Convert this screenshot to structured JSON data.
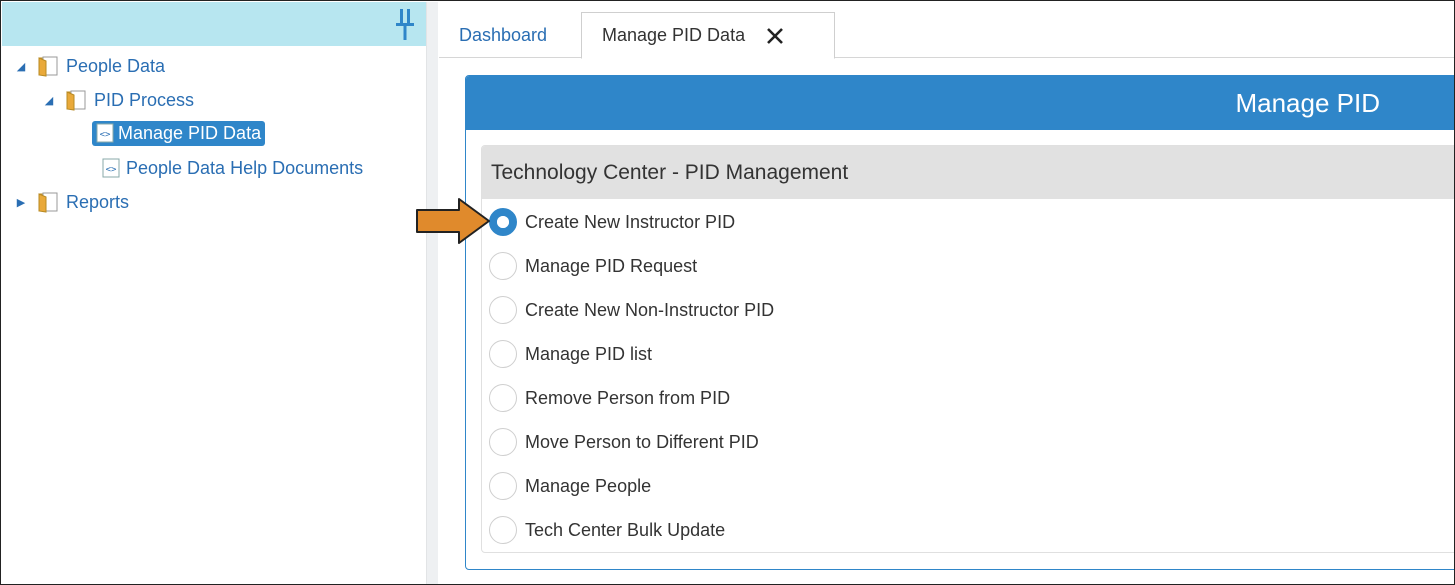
{
  "sidebar": {
    "tree": [
      {
        "label": "People Data",
        "expanded": true
      },
      {
        "label": "PID Process",
        "expanded": true
      },
      {
        "label": "Manage PID Data",
        "selected": true
      },
      {
        "label": "People Data Help Documents"
      },
      {
        "label": "Reports",
        "expanded": false
      }
    ],
    "pin_icon": "pin-icon"
  },
  "tabs": [
    {
      "label": "Dashboard"
    },
    {
      "label": "Manage PID Data",
      "active": true,
      "close_icon": "close-icon"
    }
  ],
  "panel": {
    "title": "Manage PID",
    "section_title": "Technology Center - PID Management",
    "options": [
      {
        "label": "Create New Instructor PID",
        "checked": true
      },
      {
        "label": "Manage PID Request"
      },
      {
        "label": "Create New Non-Instructor PID"
      },
      {
        "label": "Manage PID list"
      },
      {
        "label": "Remove Person from PID"
      },
      {
        "label": "Move Person to Different PID"
      },
      {
        "label": "Manage People"
      },
      {
        "label": "Tech Center Bulk Update"
      }
    ]
  },
  "colors": {
    "accent": "#2f86c9",
    "sidebar_header": "#b7e6f0",
    "section_header": "#e1e1e1",
    "annotation_arrow": "#e08a2c"
  }
}
